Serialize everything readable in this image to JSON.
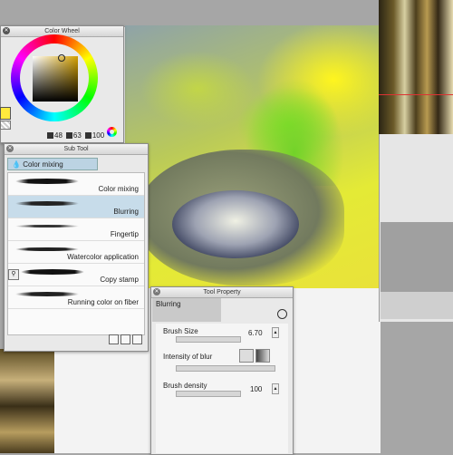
{
  "color_wheel": {
    "title": "Color Wheel",
    "h": "48",
    "s": "63",
    "v": "100",
    "main_color": "#ffea3d"
  },
  "sub_tool": {
    "title": "Sub Tool",
    "group": "Color mixing",
    "items": [
      {
        "label": "Color mixing",
        "selected": false
      },
      {
        "label": "Blurring",
        "selected": true
      },
      {
        "label": "Fingertip",
        "selected": false
      },
      {
        "label": "Watercolor application",
        "selected": false
      },
      {
        "label": "Copy stamp",
        "selected": false
      },
      {
        "label": "Running color on fiber",
        "selected": false
      }
    ]
  },
  "tool_property": {
    "title": "Tool Property",
    "tool_name": "Blurring",
    "brush_size_label": "Brush Size",
    "brush_size_value": "6.70",
    "intensity_label": "Intensity of blur",
    "density_label": "Brush density",
    "density_value": "100"
  },
  "icons": [
    "close-icon",
    "zoom-icon",
    "color-mode-icon",
    "stamp-icon",
    "new-subtool-icon",
    "delete-icon",
    "settings-icon"
  ]
}
